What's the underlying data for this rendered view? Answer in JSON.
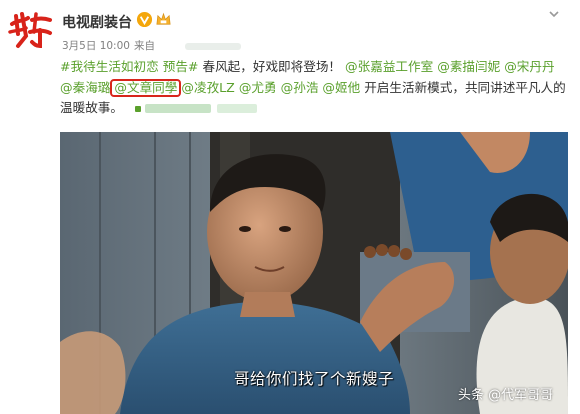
{
  "post": {
    "account_name": "电视剧装台",
    "meta_date": "3月5日 10:00",
    "meta_via": "来自",
    "text_parts": {
      "tag1": "#我待生活如初恋",
      "tag2": "预告#",
      "t1": " 春风起，好戏即将登场！",
      "m1": "@张嘉益工作室",
      "m2": "@素描闫妮",
      "m3": "@宋丹丹",
      "m4": "@秦海璐",
      "m5": "@文章同學",
      "m6": "@凌孜LZ",
      "m7": "@尤勇",
      "m8": "@孙浩",
      "m9": "@姬他",
      "t2": " 开启生活新模式，共同讲述平凡人的温暖故事。"
    }
  },
  "video": {
    "subtitle": "哥给你们找了个新嫂子",
    "watermark": "头条 @代军哥哥"
  },
  "icons": {
    "avatar": "red-calligraphy-logo",
    "verified": "verified-v-icon",
    "vip": "crown-vip-icon",
    "menu": "chevron-down-icon"
  },
  "colors": {
    "link": "#5aa02c",
    "highlight_circle": "#d8261c",
    "verified": "#f4a70c"
  }
}
